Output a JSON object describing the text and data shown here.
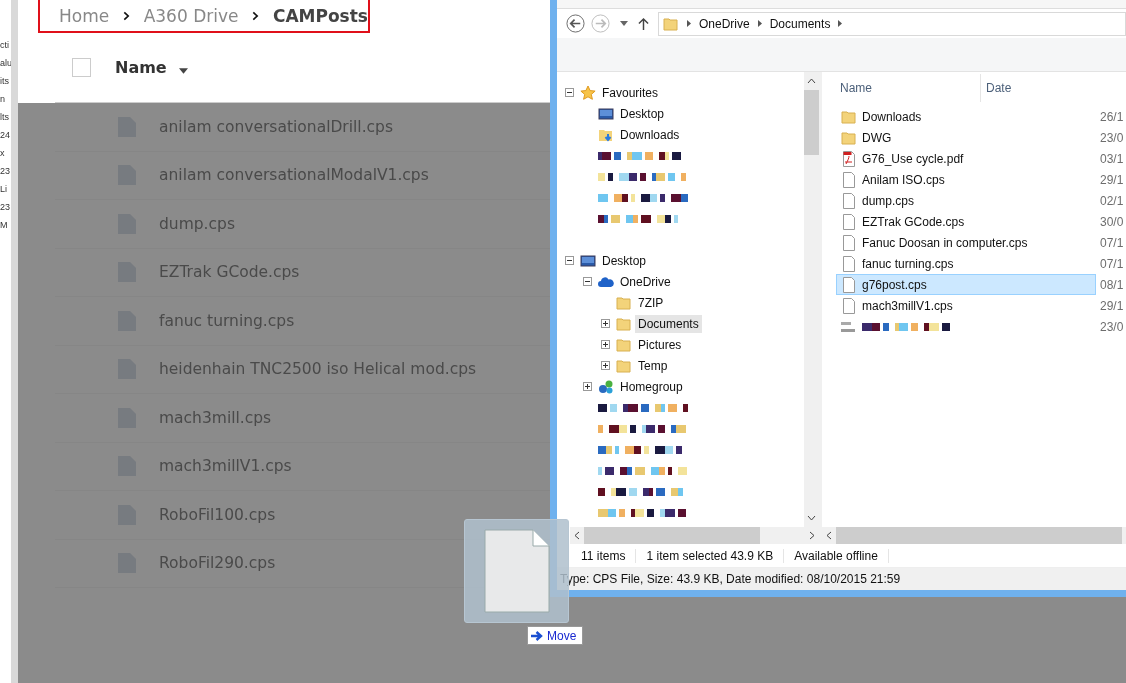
{
  "left_edge": {
    "fragments": [
      "cti",
      "alu",
      "its",
      "n",
      "lts",
      "24",
      "x",
      "23",
      "Li",
      "23",
      "M"
    ]
  },
  "web_app": {
    "breadcrumb": [
      {
        "label": "Home",
        "current": false
      },
      {
        "label": "A360 Drive",
        "current": false
      },
      {
        "label": "CAMPosts",
        "current": true
      }
    ],
    "header": {
      "select_all": {
        "checked": false
      },
      "column": "Name"
    },
    "files": [
      "anilam conversationalDrill.cps",
      "anilam conversationalModalV1.cps",
      "dump.cps",
      "EZTrak GCode.cps",
      "fanuc turning.cps",
      "heidenhain TNC2500 iso Helical mod.cps",
      "mach3mill.cps",
      "mach3millV1.cps",
      "RoboFil100.cps",
      "RoboFil290.cps"
    ]
  },
  "explorer": {
    "address": [
      "OneDrive",
      "Documents"
    ],
    "tree": [
      {
        "label": "Favourites",
        "kind": "star",
        "expanded": true,
        "children": [
          {
            "label": "Desktop",
            "kind": "desktop"
          },
          {
            "label": "Downloads",
            "kind": "downloads"
          },
          {
            "kind": "redacted"
          },
          {
            "kind": "redacted"
          },
          {
            "kind": "redacted"
          },
          {
            "kind": "redacted"
          }
        ]
      },
      {
        "kind": "spacer"
      },
      {
        "label": "Desktop",
        "kind": "desktop",
        "expanded": true,
        "children": [
          {
            "label": "OneDrive",
            "kind": "cloud",
            "expanded": true,
            "children": [
              {
                "label": "7ZIP",
                "kind": "folder",
                "selected": false
              },
              {
                "label": "Documents",
                "kind": "folder",
                "expanded": false,
                "selected": true
              },
              {
                "label": "Pictures",
                "kind": "folder",
                "expanded": false,
                "selected": false
              },
              {
                "label": "Temp",
                "kind": "folder",
                "expanded": false,
                "selected": false
              }
            ]
          },
          {
            "label": "Homegroup",
            "kind": "homegroup",
            "expanded": false
          },
          {
            "kind": "redacted"
          },
          {
            "kind": "redacted"
          },
          {
            "kind": "redacted"
          },
          {
            "kind": "redacted"
          },
          {
            "kind": "redacted"
          },
          {
            "kind": "redacted"
          }
        ]
      }
    ],
    "columns": [
      "Name",
      "Date"
    ],
    "files": [
      {
        "name": "Downloads",
        "date": "26/1",
        "kind": "folder",
        "selected": false
      },
      {
        "name": "DWG",
        "date": "23/0",
        "kind": "folder",
        "selected": false
      },
      {
        "name": "G76_Use cycle.pdf",
        "date": "03/1",
        "kind": "pdf",
        "selected": false
      },
      {
        "name": "Anilam ISO.cps",
        "date": "29/1",
        "kind": "file",
        "selected": false
      },
      {
        "name": "dump.cps",
        "date": "02/1",
        "kind": "file",
        "selected": false
      },
      {
        "name": "EZTrak GCode.cps",
        "date": "30/0",
        "kind": "file",
        "selected": false
      },
      {
        "name": "Fanuc Doosan in computer.cps",
        "date": "07/1",
        "kind": "file",
        "selected": false
      },
      {
        "name": "fanuc turning.cps",
        "date": "07/1",
        "kind": "file",
        "selected": false
      },
      {
        "name": "g76post.cps",
        "date": "08/1",
        "kind": "file",
        "selected": true
      },
      {
        "name": "mach3millV1.cps",
        "date": "29/1",
        "kind": "file",
        "selected": false
      },
      {
        "date": "23/0",
        "kind": "redacted",
        "selected": false
      }
    ],
    "status": [
      "11 items",
      "1 item selected  43.9 KB",
      "Available offline"
    ],
    "details": "Type: CPS File, Size: 43.9 KB, Date modified: 08/10/2015 21:59"
  },
  "drag": {
    "tooltip": "Move"
  }
}
